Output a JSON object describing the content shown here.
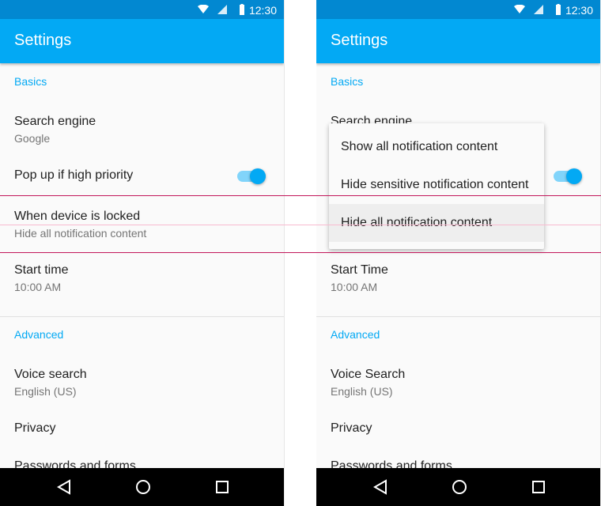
{
  "status_bar": {
    "time": "12:30",
    "icons": [
      "wifi-icon",
      "signal-icon",
      "battery-icon"
    ]
  },
  "left": {
    "title": "Settings",
    "basics_header": "Basics",
    "search_engine": {
      "title": "Search engine",
      "value": "Google"
    },
    "popup": {
      "title": "Pop up if high priority",
      "toggle_on": true
    },
    "locked": {
      "title": "When device is locked",
      "value": "Hide all notification content"
    },
    "start_time": {
      "title": "Start time",
      "value": "10:00 AM"
    },
    "advanced_header": "Advanced",
    "voice_search": {
      "title": "Voice search",
      "value": "English (US)"
    },
    "privacy": "Privacy",
    "passwords": "Passwords and forms"
  },
  "right": {
    "title": "Settings",
    "basics_header": "Basics",
    "search_engine": {
      "title": "Search engine"
    },
    "menu": {
      "options": [
        "Show all notification content",
        "Hide sensitive notification content",
        "Hide all notification content"
      ],
      "selected": 2
    },
    "start_time": {
      "title": "Start Time",
      "value": "10:00 AM"
    },
    "advanced_header": "Advanced",
    "voice_search": {
      "title": "Voice Search",
      "value": "English (US)"
    },
    "privacy": "Privacy",
    "passwords": "Passwords and forms"
  },
  "colors": {
    "primary": "#03A9F4",
    "primary_dark": "#0288D1",
    "guide": "#D81B60"
  }
}
